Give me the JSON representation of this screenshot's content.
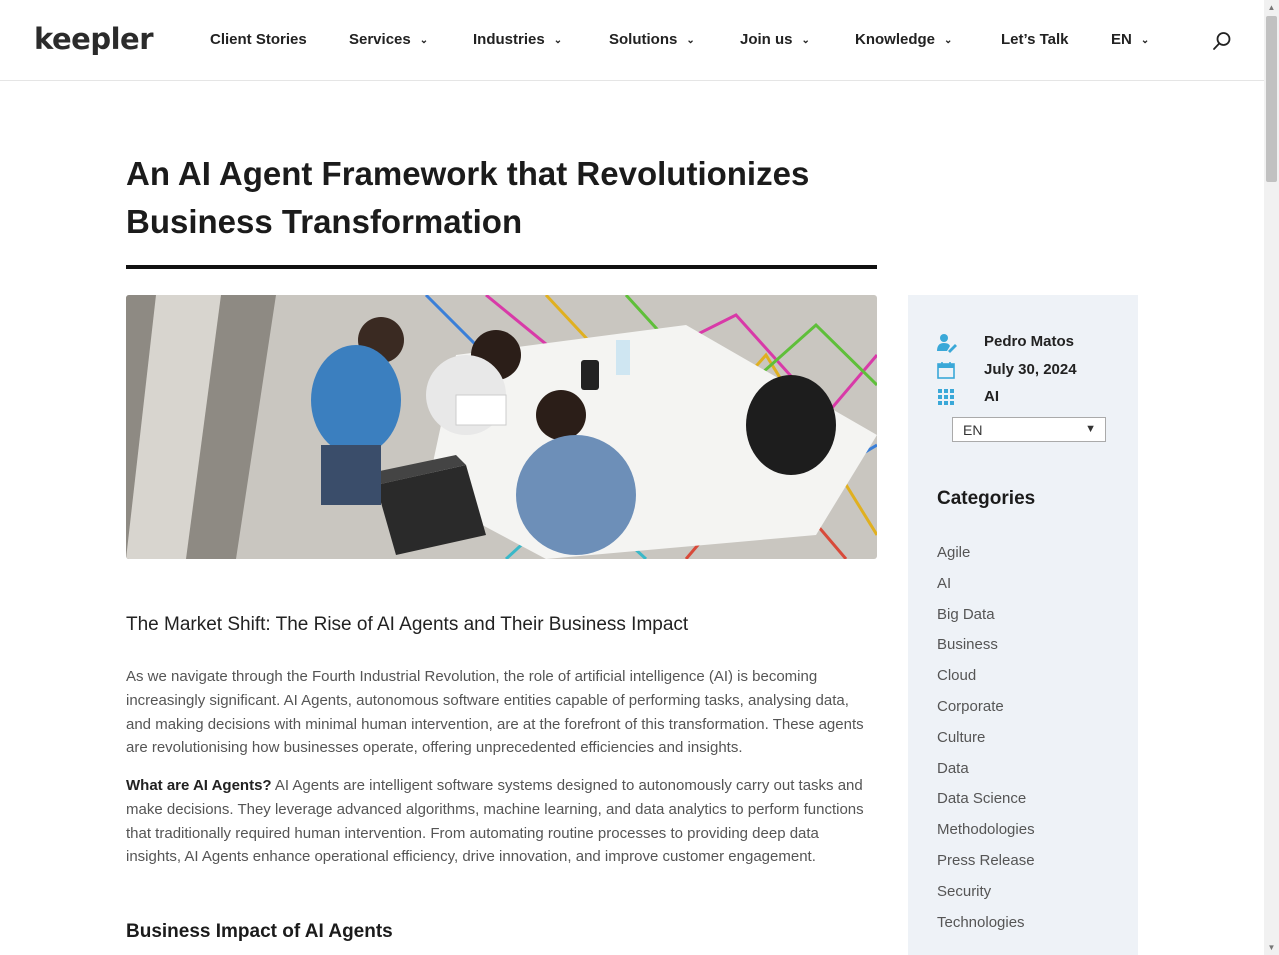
{
  "header": {
    "logo": "keepler",
    "nav": [
      {
        "label": "Client Stories",
        "dropdown": false
      },
      {
        "label": "Services",
        "dropdown": true
      },
      {
        "label": "Industries",
        "dropdown": true
      },
      {
        "label": "Solutions",
        "dropdown": true
      },
      {
        "label": "Join us",
        "dropdown": true
      },
      {
        "label": "Knowledge",
        "dropdown": true
      },
      {
        "label": "Let’s Talk",
        "dropdown": false
      },
      {
        "label": "EN",
        "dropdown": true
      }
    ],
    "search_icon": "search-icon"
  },
  "article": {
    "title": "An AI Agent Framework that Revolutionizes Business Transformation",
    "hero_image": "photo of three men working at a white table with laptop and backpack",
    "subtitle": "The Market Shift: The Rise of AI Agents and Their Business Impact",
    "paragraph1": "As we navigate through the Fourth Industrial Revolution, the role of artificial intelligence (AI) is becoming increasingly significant. AI Agents, autonomous software entities capable of performing tasks, analysing data, and making decisions with minimal human intervention, are at the forefront of this transformation. These agents are revolutionising how businesses operate, offering unprecedented efficiencies and insights.",
    "paragraph2_lead": "What are AI Agents?",
    "paragraph2_body": " AI Agents are intelligent software systems designed to autonomously carry out tasks and make decisions. They leverage advanced algorithms, machine learning, and data analytics to perform functions that traditionally required human intervention. From automating routine processes to providing deep data insights, AI Agents enhance operational efficiency, drive innovation, and improve customer engagement.",
    "section_heading": "Business Impact of AI Agents"
  },
  "sidebar": {
    "author": "Pedro Matos",
    "date": "July 30, 2024",
    "category": "AI",
    "language_select": "EN",
    "categories_heading": "Categories",
    "categories": [
      "Agile",
      "AI",
      "Big Data",
      "Business",
      "Cloud",
      "Corporate",
      "Culture",
      "Data",
      "Data Science",
      "Methodologies",
      "Press Release",
      "Security",
      "Technologies"
    ]
  },
  "colors": {
    "accent": "#3aa8d8",
    "sidebar_bg": "#eef2f7",
    "title_rule": "#111111"
  }
}
